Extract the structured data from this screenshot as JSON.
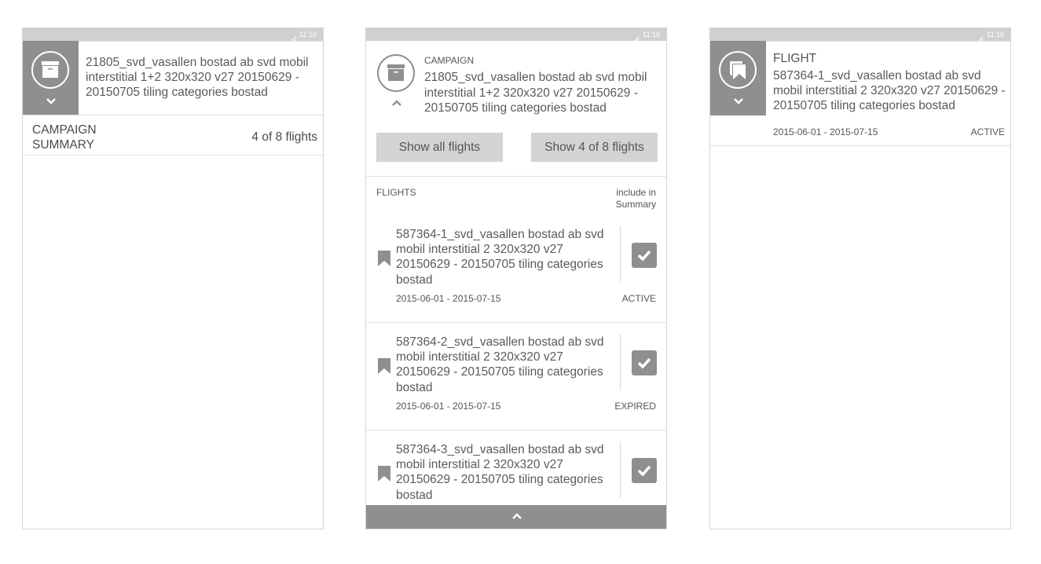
{
  "status_bar": {
    "time": "11:10"
  },
  "screen1": {
    "title": "21805_svd_vasallen bostad ab svd mobil interstitial 1+2 320x320 v27 20150629 - 20150705 tiling categories bostad",
    "summary_label": "CAMPAIGN SUMMARY",
    "summary_count": "4 of 8 flights"
  },
  "screen2": {
    "kind": "CAMPAIGN",
    "title": "21805_svd_vasallen bostad ab svd mobil interstitial 1+2 320x320 v27 20150629 - 20150705 tiling categories bostad",
    "btn_all": "Show all flights",
    "btn_some": "Show 4 of 8 flights",
    "flights_label": "FLIGHTS",
    "include_label": "include in Summary",
    "flights": [
      {
        "title": "587364-1_svd_vasallen bostad ab svd mobil interstitial 2 320x320 v27 20150629 - 20150705 tiling categories bostad",
        "dates": "2015-06-01 - 2015-07-15",
        "status": "ACTIVE",
        "included": true
      },
      {
        "title": "587364-2_svd_vasallen bostad ab svd mobil interstitial 2 320x320 v27 20150629 - 20150705 tiling categories bostad",
        "dates": "2015-06-01 - 2015-07-15",
        "status": "EXPIRED",
        "included": true
      },
      {
        "title": "587364-3_svd_vasallen bostad ab svd mobil interstitial 2 320x320 v27 20150629 - 20150705 tiling categories bostad",
        "dates": "",
        "status": "",
        "included": true
      }
    ]
  },
  "screen3": {
    "kind": "FLIGHT",
    "title": "587364-1_svd_vasallen bostad ab svd mobil interstitial 2 320x320 v27 20150629 - 20150705 tiling categories bostad",
    "dates": "2015-06-01 - 2015-07-15",
    "status": "ACTIVE"
  },
  "colors": {
    "accent_grey": "#8f8f8f",
    "status_bar": "#d0d0d0",
    "button": "#d4d4d4",
    "divider": "#e3e3e3"
  }
}
